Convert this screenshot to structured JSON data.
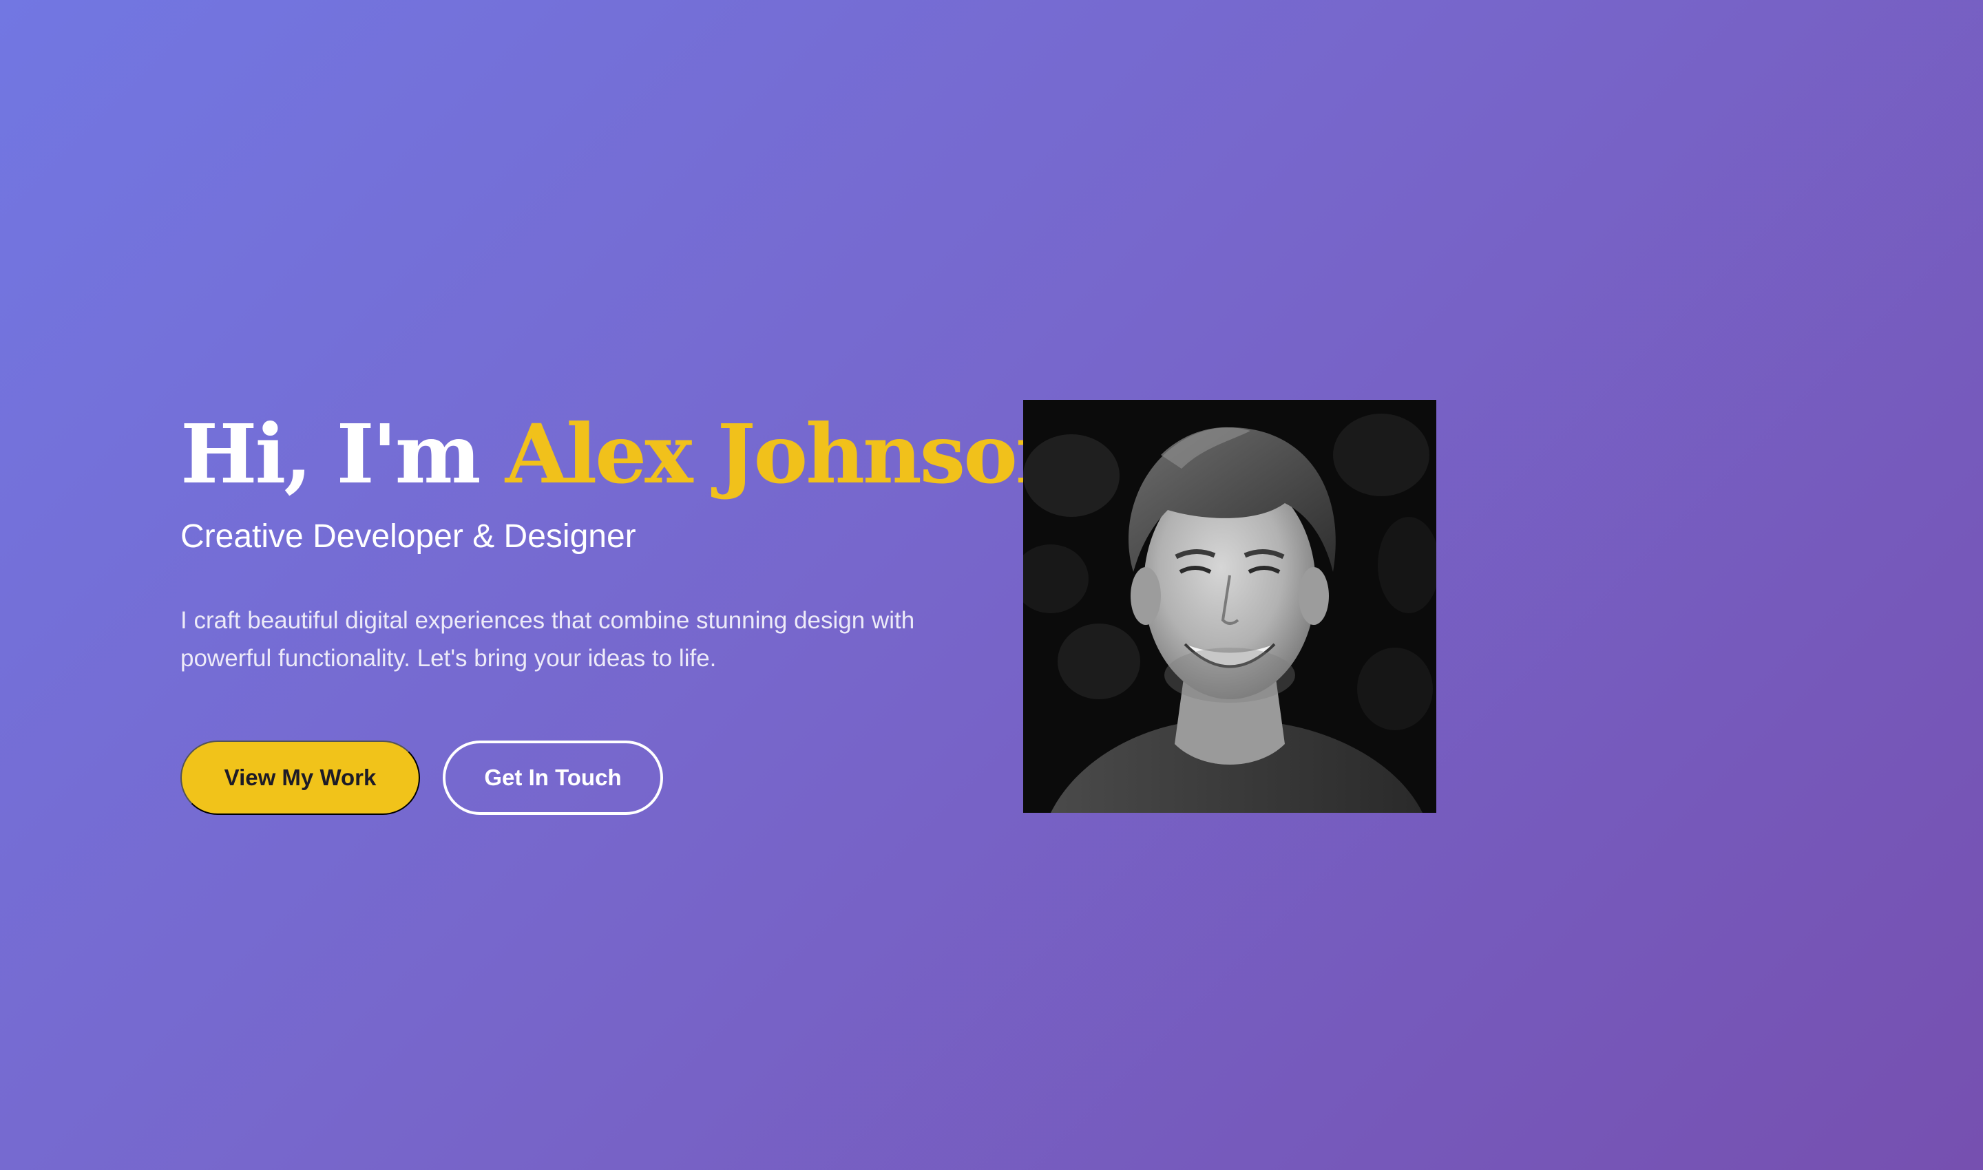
{
  "hero": {
    "greeting": "Hi, I'm",
    "name": "Alex Johnson",
    "subtitle": "Creative Developer & Designer",
    "description": "I craft beautiful digital experiences that combine stunning design with powerful functionality. Let's bring your ideas to life.",
    "primary_button": "View My Work",
    "secondary_button": "Get In Touch"
  },
  "colors": {
    "gradient_start": "#7277e2",
    "gradient_end": "#7650b0",
    "accent": "#f1c11b",
    "text": "#ffffff"
  }
}
